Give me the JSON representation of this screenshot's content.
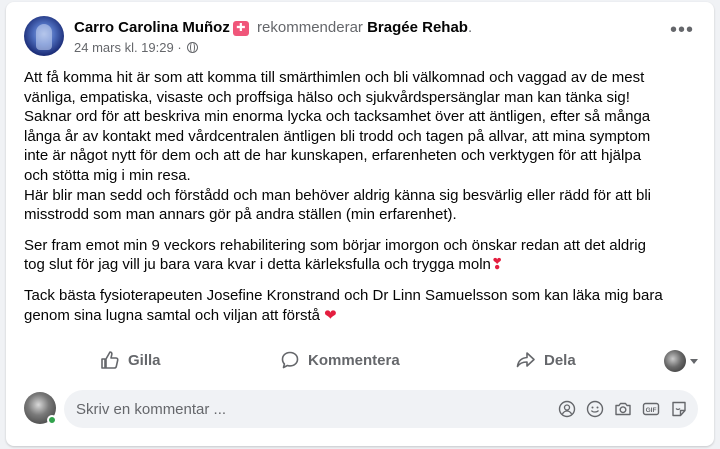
{
  "post": {
    "author": "Carro Carolina Muñoz",
    "badge_icon": "recommend-badge-icon",
    "recommends_text": "rekommenderar",
    "page_name": "Bragée Rehab",
    "timestamp": "24 mars kl. 19:29 ·",
    "body": {
      "p1_lines": [
        "Att få komma hit är som att komma till smärthimlen och bli välkomnad och vaggad av de mest",
        "vänliga, empatiska, visaste och proffsiga hälso och sjukvårdspersänglar man kan tänka sig!",
        "Saknar ord för att beskriva min enorma lycka och tacksamhet över att äntligen, efter så många",
        "långa år av kontakt med vårdcentralen äntligen bli trodd och tagen på allvar, att mina symptom",
        "inte är något nytt för dem och att de har kunskapen, erfarenheten och verktygen för att hjälpa",
        "och stötta mig i min resa.",
        "Här blir man sedd och förstådd och man behöver aldrig känna sig besvärlig eller rädd för att bli",
        "misstrodd som man annars gör på andra ställen (min erfarenhet)."
      ],
      "p2_lines": [
        "Ser fram emot min 9 veckors rehabilitering som börjar imorgon och önskar redan att det aldrig",
        "tog slut för jag vill  ju bara vara kvar i detta kärleksfulla och trygga moln"
      ],
      "p2_emoji": "❣",
      "p3_lines": [
        "Tack bästa fysioterapeuten Josefine Kronstrand och Dr Linn Samuelsson som kan läka mig bara",
        "genom sina lugna samtal och viljan att förstå "
      ],
      "p3_emoji": "❤"
    }
  },
  "actions": {
    "like_label": "Gilla",
    "comment_label": "Kommentera",
    "share_label": "Dela"
  },
  "composer": {
    "placeholder": "Skriv en kommentar ..."
  },
  "colors": {
    "secondary_text": "#65676b",
    "online_green": "#31a24c",
    "heart_red": "#e41e3f",
    "page_bg": "#f0f2f5"
  }
}
